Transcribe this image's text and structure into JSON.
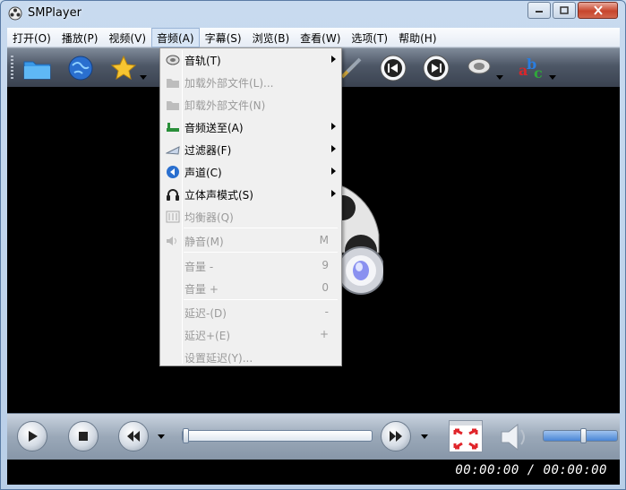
{
  "window": {
    "title": "SMPlayer"
  },
  "menubar": [
    {
      "label": "打开(O)"
    },
    {
      "label": "播放(P)"
    },
    {
      "label": "视频(V)"
    },
    {
      "label": "音频(A)"
    },
    {
      "label": "字幕(S)"
    },
    {
      "label": "浏览(B)"
    },
    {
      "label": "查看(W)"
    },
    {
      "label": "选项(T)"
    },
    {
      "label": "帮助(H)"
    }
  ],
  "audio_menu": {
    "items": [
      {
        "label": "音轨(T)",
        "shortcut": "",
        "submenu": true,
        "enabled": true,
        "icon": "audio-track-icon"
      },
      {
        "label": "加载外部文件(L)...",
        "shortcut": "",
        "submenu": false,
        "enabled": false,
        "icon": "folder-icon"
      },
      {
        "label": "卸载外部文件(N)",
        "shortcut": "",
        "submenu": false,
        "enabled": false,
        "icon": "folder-icon"
      },
      {
        "label": "音频送至(A)",
        "shortcut": "",
        "submenu": true,
        "enabled": true,
        "icon": "audio-output-icon"
      },
      {
        "label": "过滤器(F)",
        "shortcut": "",
        "submenu": true,
        "enabled": true,
        "icon": "filter-icon"
      },
      {
        "label": "声道(C)",
        "shortcut": "",
        "submenu": true,
        "enabled": true,
        "icon": "channels-icon"
      },
      {
        "label": "立体声模式(S)",
        "shortcut": "",
        "submenu": true,
        "enabled": true,
        "icon": "headphones-icon"
      },
      {
        "label": "均衡器(Q)",
        "shortcut": "",
        "submenu": false,
        "enabled": false,
        "icon": "equalizer-icon"
      },
      {
        "label": "静音(M)",
        "shortcut": "M",
        "submenu": false,
        "enabled": false,
        "icon": "mute-icon"
      },
      {
        "label": "音量 -",
        "shortcut": "9",
        "submenu": false,
        "enabled": false,
        "icon": ""
      },
      {
        "label": "音量 +",
        "shortcut": "0",
        "submenu": false,
        "enabled": false,
        "icon": ""
      },
      {
        "label": "延迟-(D)",
        "shortcut": "-",
        "submenu": false,
        "enabled": false,
        "icon": ""
      },
      {
        "label": "延迟+(E)",
        "shortcut": "+",
        "submenu": false,
        "enabled": false,
        "icon": ""
      },
      {
        "label": "设置延迟(Y)...",
        "shortcut": "",
        "submenu": false,
        "enabled": false,
        "icon": ""
      }
    ]
  },
  "status": {
    "time": "00:00:00 / 00:00:00"
  },
  "player": {
    "progress": 0.0,
    "volume": 0.55
  }
}
